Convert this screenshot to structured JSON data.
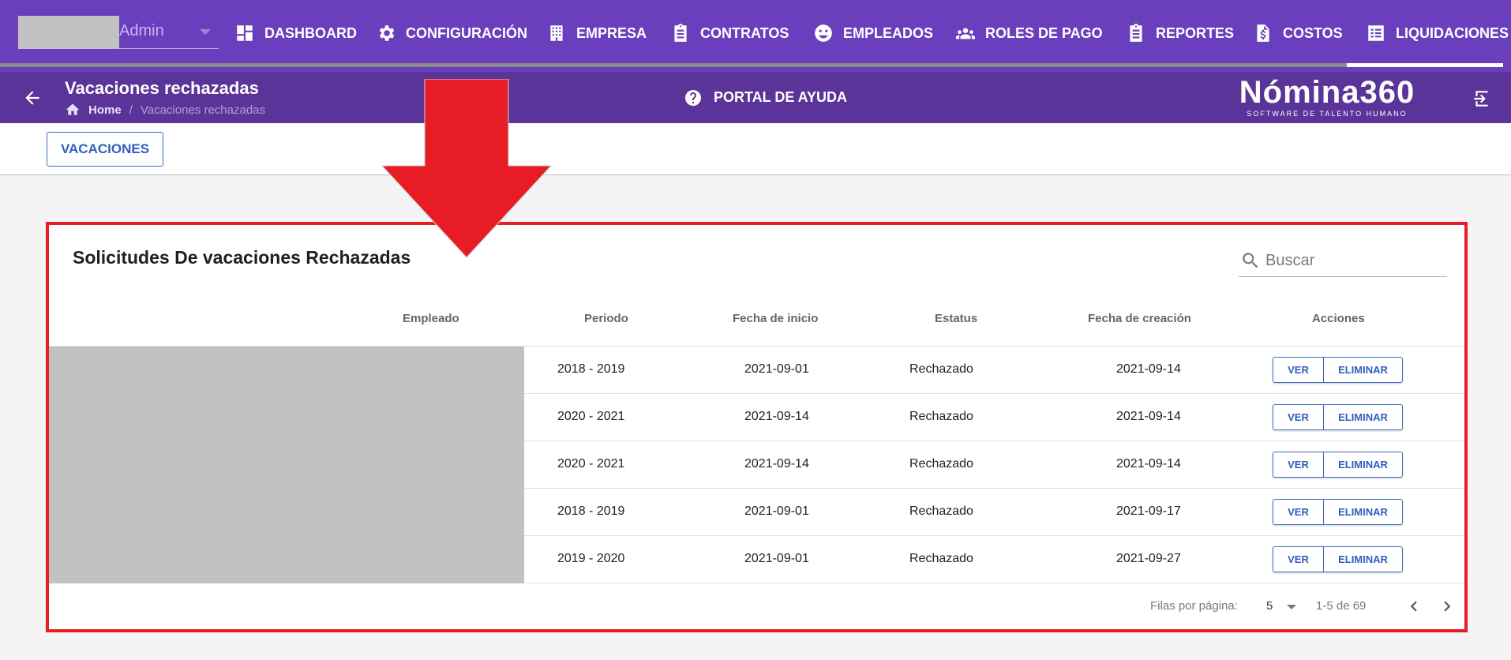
{
  "user": {
    "name": "Admin"
  },
  "nav": {
    "items": [
      {
        "label": "DASHBOARD",
        "icon": "dashboard-icon"
      },
      {
        "label": "CONFIGURACIÓN",
        "icon": "gear-icon"
      },
      {
        "label": "EMPRESA",
        "icon": "building-icon"
      },
      {
        "label": "CONTRATOS",
        "icon": "clipboard-icon"
      },
      {
        "label": "EMPLEADOS",
        "icon": "face-icon"
      },
      {
        "label": "ROLES DE PAGO",
        "icon": "people-icon"
      },
      {
        "label": "REPORTES",
        "icon": "clipboard-icon"
      },
      {
        "label": "COSTOS",
        "icon": "dollar-file-icon"
      },
      {
        "label": "LIQUIDACIONES",
        "icon": "list-icon"
      }
    ],
    "active": "LIQUIDACIONES"
  },
  "header": {
    "title": "Vacaciones rechazadas",
    "breadcrumb": {
      "home": "Home",
      "separator": "/",
      "current": "Vacaciones rechazadas"
    },
    "help_label": "PORTAL DE AYUDA",
    "logo_text": "Nómina360",
    "logo_tagline": "SOFTWARE DE TALENTO HUMANO"
  },
  "tabs": {
    "vacaciones_label": "VACACIONES"
  },
  "card": {
    "title": "Solicitudes De vacaciones Rechazadas",
    "search_placeholder": "Buscar",
    "columns": [
      "Empleado",
      "Periodo",
      "Fecha de inicio",
      "Estatus",
      "Fecha de creación",
      "Acciones"
    ],
    "rows": [
      {
        "periodo": "2018 - 2019",
        "fecha_inicio": "2021-09-01",
        "estatus": "Rechazado",
        "fecha_creacion": "2021-09-14"
      },
      {
        "periodo": "2020 - 2021",
        "fecha_inicio": "2021-09-14",
        "estatus": "Rechazado",
        "fecha_creacion": "2021-09-14"
      },
      {
        "periodo": "2020 - 2021",
        "fecha_inicio": "2021-09-14",
        "estatus": "Rechazado",
        "fecha_creacion": "2021-09-14"
      },
      {
        "periodo": "2018 - 2019",
        "fecha_inicio": "2021-09-01",
        "estatus": "Rechazado",
        "fecha_creacion": "2021-09-17"
      },
      {
        "periodo": "2019 - 2020",
        "fecha_inicio": "2021-09-01",
        "estatus": "Rechazado",
        "fecha_creacion": "2021-09-27"
      }
    ],
    "action_view": "VER",
    "action_delete": "ELIMINAR",
    "footer": {
      "rows_per_page_label": "Filas por página:",
      "rows_per_page": "5",
      "range": "1-5 de 69"
    }
  },
  "colors": {
    "nav_bg": "#6a3fbd",
    "subbar_bg": "#5a3498",
    "accent_blue": "#2f5fbb",
    "highlight_red": "#e81c24"
  }
}
